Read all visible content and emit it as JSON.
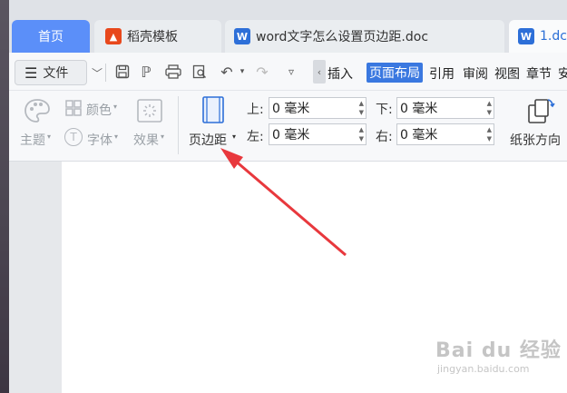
{
  "tabs": [
    {
      "label": "首页",
      "active": false
    },
    {
      "label": "稻壳模板",
      "icon": "fire-icon"
    },
    {
      "label": "word文字怎么设置页边距.doc",
      "icon": "wps-writer-icon"
    },
    {
      "label": "1.dc",
      "icon": "wps-writer-icon",
      "active": true
    }
  ],
  "toolbar": {
    "file_label": "文件",
    "menus": [
      "插入",
      "页面布局",
      "引用",
      "审阅",
      "视图",
      "章节",
      "安"
    ],
    "active_menu": "页面布局"
  },
  "ribbon": {
    "theme_label": "主题",
    "color_label": "颜色",
    "font_label": "字体",
    "effect_label": "效果",
    "margin_label": "页边距",
    "orientation_label": "纸张方向",
    "top_label": "上:",
    "bottom_label": "下:",
    "left_label": "左:",
    "right_label": "右:",
    "top_value": "0 毫米",
    "bottom_value": "0 毫米",
    "left_value": "0 毫米",
    "right_value": "0 毫米"
  },
  "watermark": {
    "main": "Bai du 经验",
    "sub": "jingyan.baidu.com"
  },
  "colors": {
    "accent": "#3a78e0",
    "home_tab": "#5b8ff9",
    "arrow": "#e8383d"
  }
}
